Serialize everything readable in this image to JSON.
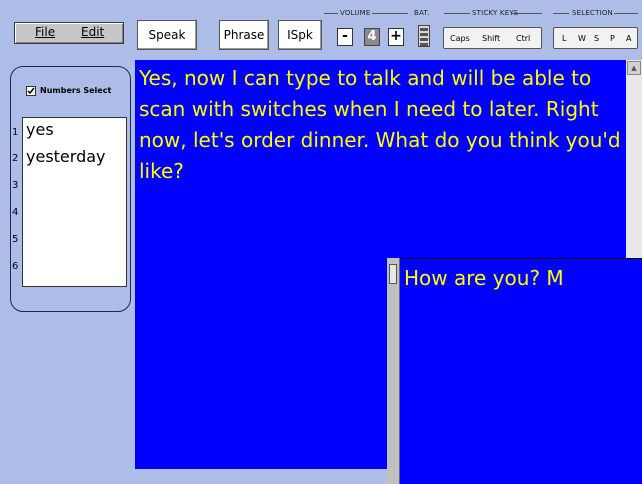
{
  "menu": {
    "file": "File",
    "edit": "Edit"
  },
  "toolbar": {
    "speak": "Speak",
    "phrase": "Phrase",
    "ispk": "ISpk"
  },
  "volume": {
    "label": "VOLUME",
    "minus": "-",
    "value": "4",
    "plus": "+"
  },
  "battery": {
    "label": "BAT."
  },
  "sticky_keys": {
    "label": "STICKY KEYS",
    "caps": "Caps",
    "shift": "Shift",
    "ctrl": "Ctrl"
  },
  "selection": {
    "label": "SELECTION",
    "l": "L",
    "w": "W",
    "s": "S",
    "p": "P",
    "a": "A"
  },
  "prediction": {
    "numbers_select_label": "Numbers Select",
    "numbers_select_checked": true,
    "numbers": [
      "1",
      "2",
      "3",
      "4",
      "5",
      "6"
    ],
    "words": [
      "yes",
      "yesterday",
      "",
      "",
      "",
      ""
    ]
  },
  "main_text": "Yes, now I can type to talk and will be able to scan with switches when I need to later. Right now,  let's order dinner. What do you think you'd like?",
  "popup_text": "How are you? M",
  "colors": {
    "background": "#aebde8",
    "text_area": "#0000ff",
    "text": "#ffff00"
  }
}
